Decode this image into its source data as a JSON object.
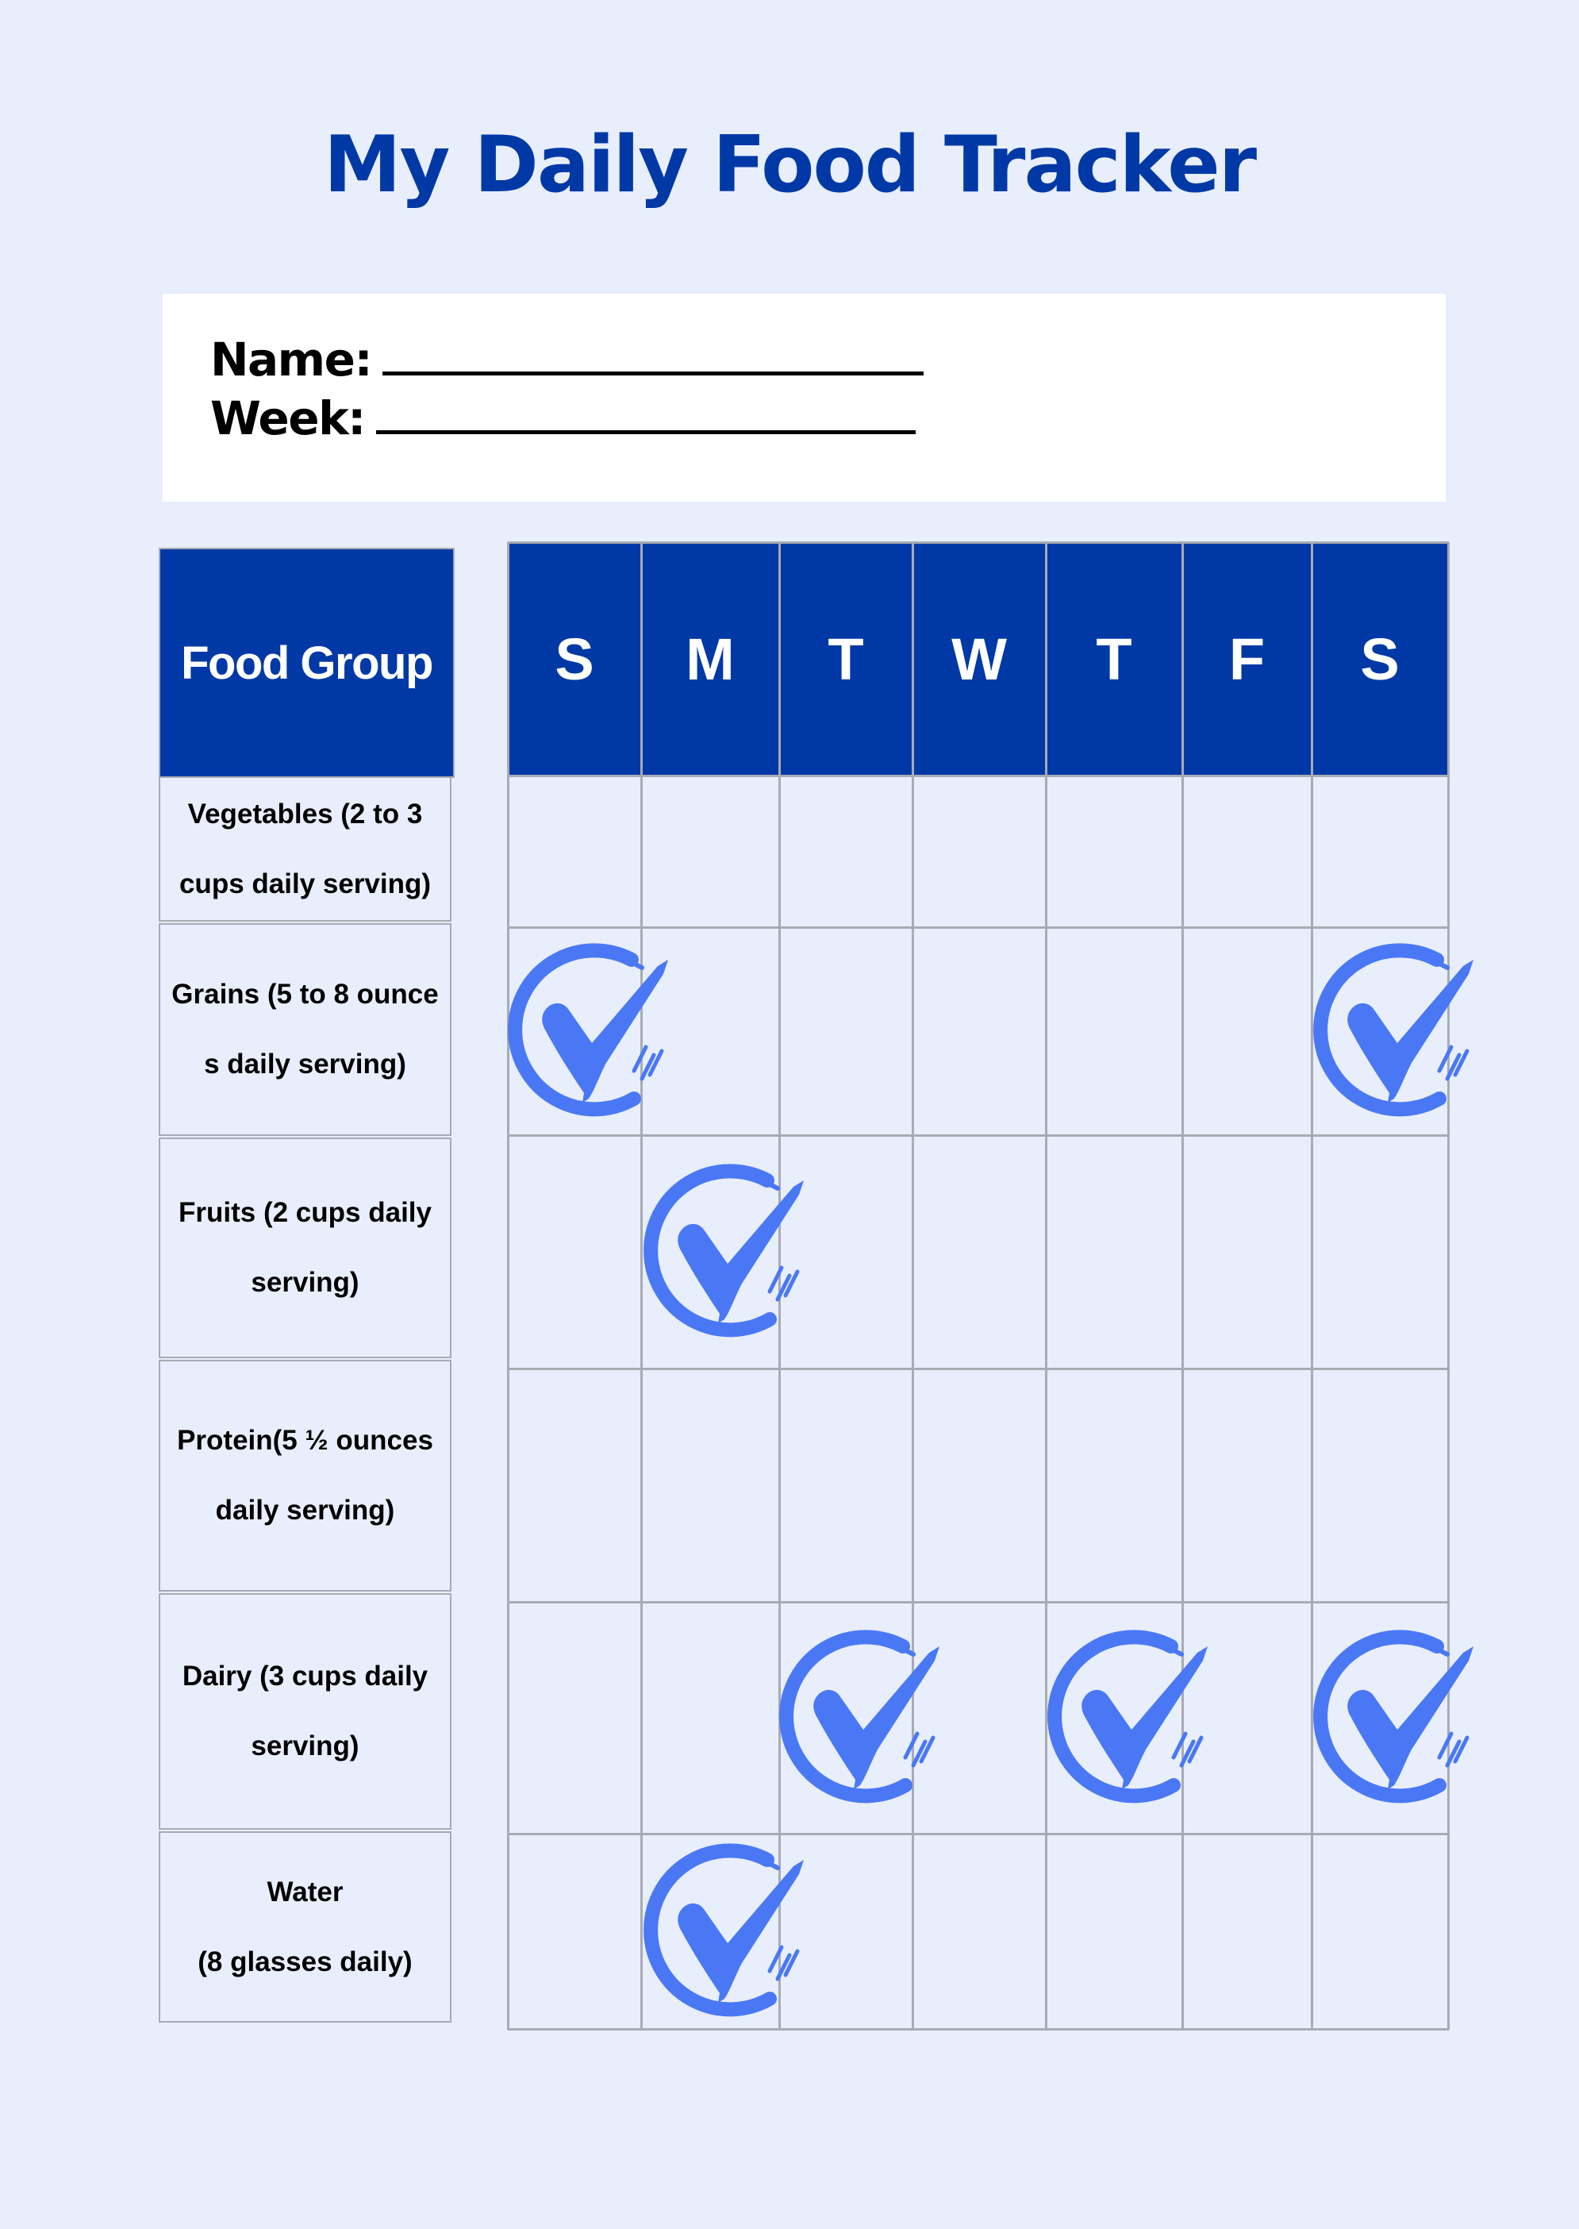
{
  "title": "My Daily Food Tracker",
  "info": {
    "name_label": "Name:",
    "week_label": "Week:"
  },
  "table": {
    "food_group_header": "Food Group",
    "days": [
      "S",
      "M",
      "T",
      "W",
      "T",
      "F",
      "S"
    ],
    "rows": [
      {
        "label_lines": [
          "Vegetables (2 to 3",
          "cups daily serving)"
        ],
        "checked_days": []
      },
      {
        "label_lines": [
          "Grains (5 to 8 ounce",
          "s daily serving)"
        ],
        "checked_days": [
          0,
          6
        ]
      },
      {
        "label_lines": [
          "Fruits (2 cups daily",
          "serving)"
        ],
        "checked_days": [
          1
        ]
      },
      {
        "label_lines": [
          "Protein(5 ½ ounces",
          "daily serving)"
        ],
        "checked_days": []
      },
      {
        "label_lines": [
          "Dairy (3 cups daily",
          "serving)"
        ],
        "checked_days": [
          2,
          4,
          6
        ]
      },
      {
        "label_lines": [
          "Water",
          "(8 glasses daily)"
        ],
        "checked_days": [
          1
        ]
      }
    ]
  },
  "colors": {
    "primary": "#0039a6",
    "check": "#4a78f5",
    "background": "#e8eefc",
    "grid_line": "#a8abb3"
  },
  "icons": {
    "check": "circled-checkmark-icon"
  }
}
